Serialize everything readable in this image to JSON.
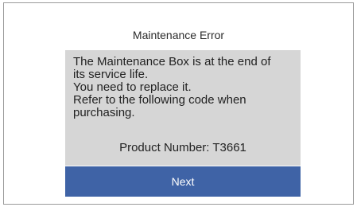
{
  "dialog": {
    "title": "Maintenance Error",
    "message": "The Maintenance Box is at the end of\nits service life.\nYou need to replace it.\nRefer to the following code when\npurchasing.",
    "product_number": "Product Number: T3661",
    "next_label": "Next"
  },
  "colors": {
    "message_background": "#d6d6d6",
    "button_background": "#3f63a6",
    "button_text": "#ffffff"
  }
}
